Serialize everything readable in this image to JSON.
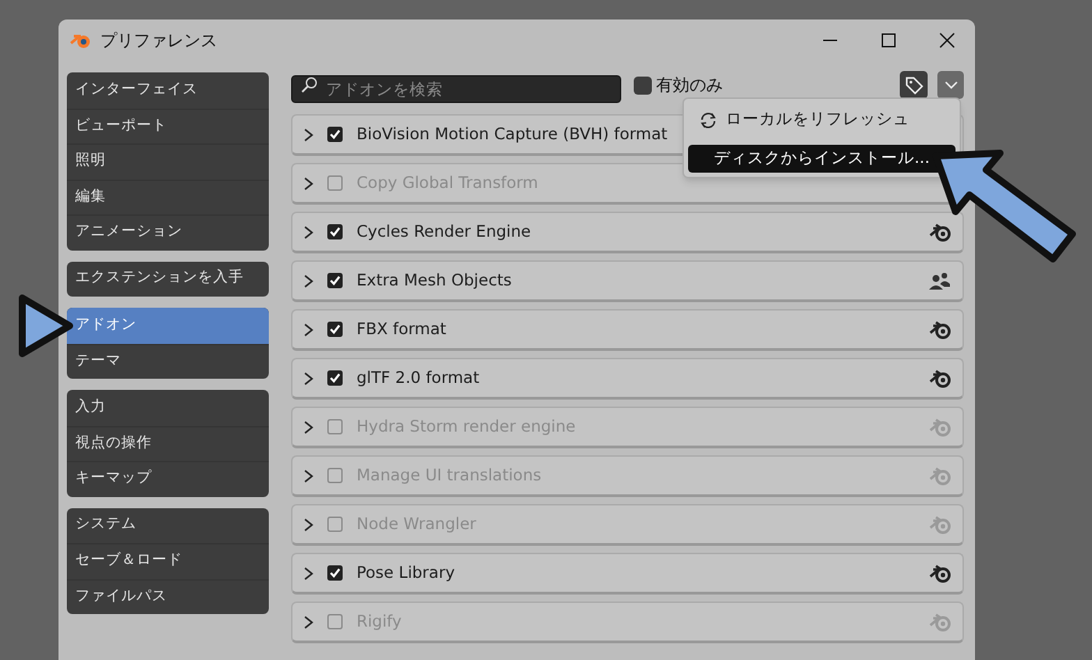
{
  "window": {
    "title": "プリファレンス"
  },
  "sidebar": {
    "groups": [
      {
        "items": [
          {
            "label": "インターフェイス",
            "selected": false
          },
          {
            "label": "ビューポート",
            "selected": false
          },
          {
            "label": "照明",
            "selected": false
          },
          {
            "label": "編集",
            "selected": false
          },
          {
            "label": "アニメーション",
            "selected": false
          }
        ]
      },
      {
        "items": [
          {
            "label": "エクステンションを入手",
            "selected": false
          }
        ]
      },
      {
        "items": [
          {
            "label": "アドオン",
            "selected": true
          },
          {
            "label": "テーマ",
            "selected": false
          }
        ]
      },
      {
        "items": [
          {
            "label": "入力",
            "selected": false
          },
          {
            "label": "視点の操作",
            "selected": false
          },
          {
            "label": "キーマップ",
            "selected": false
          }
        ]
      },
      {
        "items": [
          {
            "label": "システム",
            "selected": false
          },
          {
            "label": "セーブ＆ロード",
            "selected": false
          },
          {
            "label": "ファイルパス",
            "selected": false
          }
        ]
      }
    ]
  },
  "toolbar": {
    "search": {
      "placeholder": "アドオンを検索"
    },
    "enabled_only": {
      "label": "有効のみ",
      "checked": false
    }
  },
  "menu": {
    "items": [
      {
        "label": "ローカルをリフレッシュ",
        "kind": "refresh",
        "selected": false
      },
      {
        "label": "ディスクからインストール...",
        "kind": "plain",
        "selected": true
      }
    ]
  },
  "addons": [
    {
      "name": "BioVision Motion Capture (BVH) format",
      "enabled": true
    },
    {
      "name": "Copy Global Transform",
      "enabled": false
    },
    {
      "name": "Cycles Render Engine",
      "enabled": true,
      "kind": "official"
    },
    {
      "name": "Extra Mesh Objects",
      "enabled": true,
      "kind": "community"
    },
    {
      "name": "FBX format",
      "enabled": true,
      "kind": "official"
    },
    {
      "name": "glTF 2.0 format",
      "enabled": true,
      "kind": "official"
    },
    {
      "name": "Hydra Storm render engine",
      "enabled": false,
      "kind": "official"
    },
    {
      "name": "Manage UI translations",
      "enabled": false,
      "kind": "official"
    },
    {
      "name": "Node Wrangler",
      "enabled": false,
      "kind": "official"
    },
    {
      "name": "Pose Library",
      "enabled": true,
      "kind": "official"
    },
    {
      "name": "Rigify",
      "enabled": false,
      "kind": "official"
    }
  ]
}
